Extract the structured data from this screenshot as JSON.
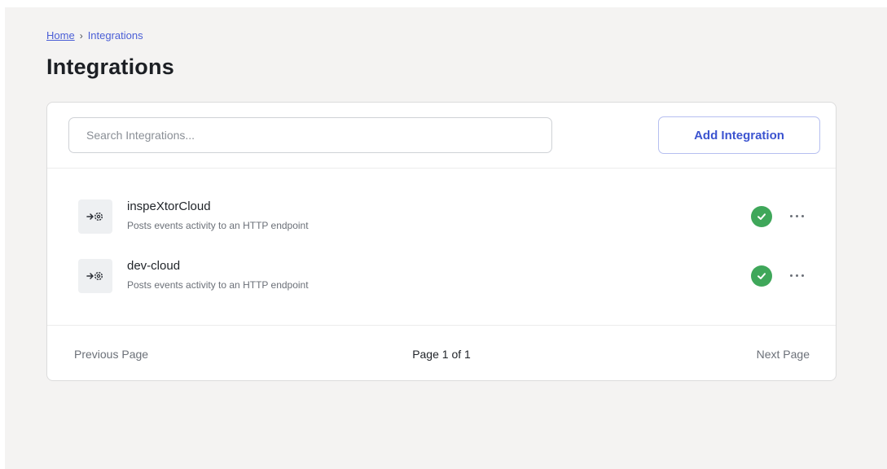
{
  "breadcrumb": {
    "home": "Home",
    "separator": "›",
    "current": "Integrations"
  },
  "page": {
    "title": "Integrations"
  },
  "search": {
    "placeholder": "Search Integrations..."
  },
  "actions": {
    "add_label": "Add Integration"
  },
  "integrations": [
    {
      "name": "inspeXtorCloud",
      "description": "Posts events activity to an HTTP endpoint",
      "icon": "webhook-gear-icon",
      "status": "active"
    },
    {
      "name": "dev-cloud",
      "description": "Posts events activity to an HTTP endpoint",
      "icon": "webhook-gear-icon",
      "status": "active"
    }
  ],
  "pagination": {
    "previous_label": "Previous Page",
    "page_label": "Page 1 of 1",
    "next_label": "Next Page"
  },
  "colors": {
    "background": "#f4f3f2",
    "accent": "#3c54d0",
    "link": "#4a5ed6",
    "status_ok": "#3fa75a"
  }
}
